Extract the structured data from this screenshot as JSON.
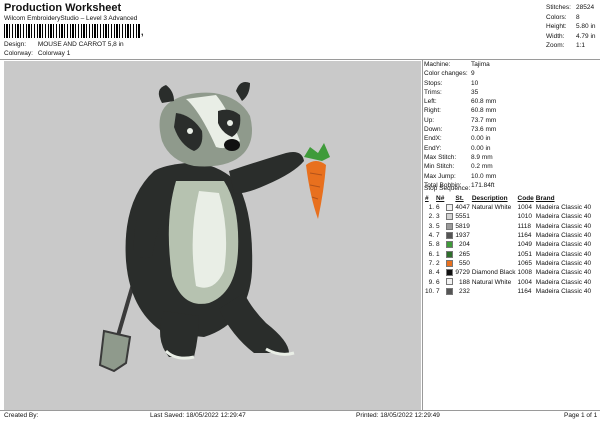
{
  "header": {
    "title": "Production Worksheet",
    "software": "Wilcom EmbroideryStudio – Level 3 Advanced",
    "barcode_mark": ","
  },
  "meta": {
    "design_label": "Design:",
    "design_value": "MOUSE AND CARROT 5,8 in",
    "colorway_label": "Colorway:",
    "colorway_value": "Colorway 1"
  },
  "stats": [
    {
      "label": "Stitches:",
      "value": "28524"
    },
    {
      "label": "Colors:",
      "value": "8"
    },
    {
      "label": "Height:",
      "value": "5.80 in"
    },
    {
      "label": "Width:",
      "value": "4.79 in"
    },
    {
      "label": "Zoom:",
      "value": "1:1"
    }
  ],
  "info": [
    {
      "label": "Machine:",
      "value": "Tajima"
    },
    {
      "label": "Color changes:",
      "value": "9"
    },
    {
      "label": "Stops:",
      "value": "10"
    },
    {
      "label": "Trims:",
      "value": "35"
    },
    {
      "label": "Left:",
      "value": "60.8 mm"
    },
    {
      "label": "Right:",
      "value": "60.8 mm"
    },
    {
      "label": "Up:",
      "value": "73.7 mm"
    },
    {
      "label": "Down:",
      "value": "73.6 mm"
    },
    {
      "label": "EndX:",
      "value": "0.00 in"
    },
    {
      "label": "EndY:",
      "value": "0.00 in"
    },
    {
      "label": "Max Stitch:",
      "value": "8.9 mm"
    },
    {
      "label": "Min Stitch:",
      "value": "0.2 mm"
    },
    {
      "label": "Max Jump:",
      "value": "10.0 mm"
    },
    {
      "label": "Total Bobbin:",
      "value": "171.84ft"
    }
  ],
  "sequence": {
    "title": "Stop Sequence:",
    "headers": {
      "num": "#",
      "n": "N#",
      "st": "St.",
      "desc": "Description",
      "code": "Code",
      "brand": "Brand"
    },
    "rows": [
      {
        "num": "1.",
        "n": "6",
        "st": "4047",
        "desc": "Natural White",
        "code": "1004",
        "brand": "Madeira Classic 40",
        "color": "#f2f2f2"
      },
      {
        "num": "2.",
        "n": "3",
        "st": "5551",
        "desc": "",
        "code": "1010",
        "brand": "Madeira Classic 40",
        "color": "#d2d2d2"
      },
      {
        "num": "3.",
        "n": "5",
        "st": "5819",
        "desc": "",
        "code": "1118",
        "brand": "Madeira Classic 40",
        "color": "#9a9a9a"
      },
      {
        "num": "4.",
        "n": "7",
        "st": "1937",
        "desc": "",
        "code": "1164",
        "brand": "Madeira Classic 40",
        "color": "#555555"
      },
      {
        "num": "5.",
        "n": "8",
        "st": "204",
        "desc": "",
        "code": "1049",
        "brand": "Madeira Classic 40",
        "color": "#3f9b3a"
      },
      {
        "num": "6.",
        "n": "1",
        "st": "265",
        "desc": "",
        "code": "1051",
        "brand": "Madeira Classic 40",
        "color": "#2e6f2c"
      },
      {
        "num": "7.",
        "n": "2",
        "st": "550",
        "desc": "",
        "code": "1065",
        "brand": "Madeira Classic 40",
        "color": "#e8701e"
      },
      {
        "num": "8.",
        "n": "4",
        "st": "9729",
        "desc": "Diamond Black",
        "code": "1008",
        "brand": "Madeira Classic 40",
        "color": "#111111"
      },
      {
        "num": "9.",
        "n": "6",
        "st": "188",
        "desc": "Natural White",
        "code": "1004",
        "brand": "Madeira Classic 40",
        "color": "#f2f2f2"
      },
      {
        "num": "10.",
        "n": "7",
        "st": "232",
        "desc": "",
        "code": "1164",
        "brand": "Madeira Classic 40",
        "color": "#555555"
      }
    ]
  },
  "footer": {
    "created_by": "Created By:",
    "last_saved": "Last Saved: 18/05/2022 12:29:47",
    "printed": "Printed: 18/05/2022 12:29:49",
    "page": "Page 1 of 1"
  }
}
